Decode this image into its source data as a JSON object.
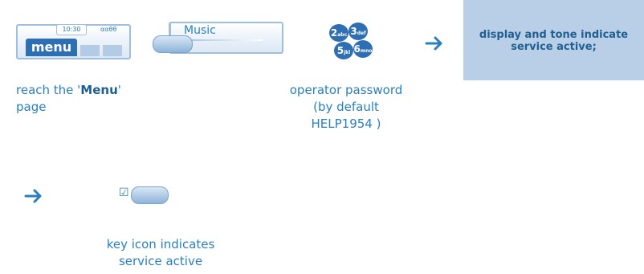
{
  "step1": {
    "screen": {
      "time": "10:30",
      "status_icons": "ααθθ",
      "menu_label": "menu"
    },
    "caption_prefix": "reach the '",
    "caption_bold": "Menu",
    "caption_suffix": "'",
    "caption_line2": "page"
  },
  "step2": {
    "screen": {
      "label": "Music"
    }
  },
  "step3": {
    "keys": [
      {
        "digit": "2",
        "letters": "abc"
      },
      {
        "digit": "3",
        "letters": "def"
      },
      {
        "digit": "5",
        "letters": "jkl"
      },
      {
        "digit": "6",
        "letters": "mno"
      }
    ],
    "caption_line1": "operator password",
    "caption_line2": "(by default",
    "caption_line3": "HELP1954 )"
  },
  "result_box": {
    "line1": "display and tone indicate",
    "line2": "service active;"
  },
  "step4": {
    "checkbox_glyph": "☑",
    "caption_line1": "key icon indicates",
    "caption_line2": "service active"
  },
  "colors": {
    "accent": "#2a7fbf",
    "box": "#b9cfe8",
    "dark": "#1f5f91",
    "key": "#2e6fb3"
  }
}
